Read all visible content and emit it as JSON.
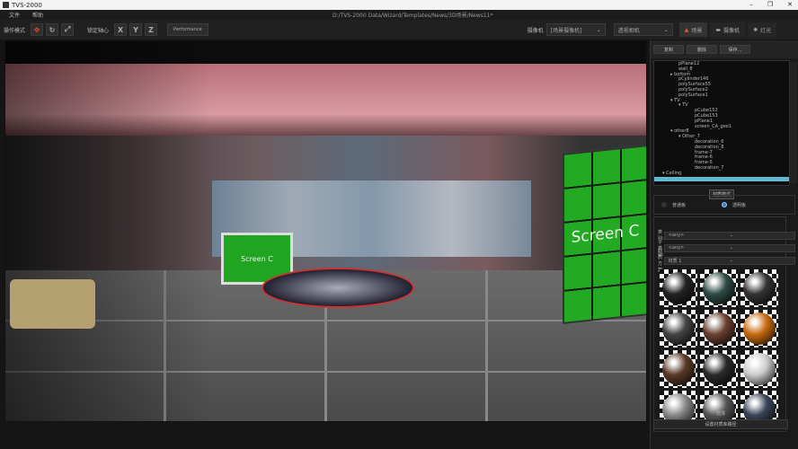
{
  "window": {
    "title": "TVS-2000",
    "minimize": "–",
    "restore": "❐",
    "close": "✕"
  },
  "menu": {
    "items": [
      "文件",
      "帮助"
    ],
    "path": "D:/TVS-2000 Data/Wizard/Templates/News/3D场景/News11*"
  },
  "toolbar": {
    "mode_label": "操作模式",
    "lock_label": "锁定轴心",
    "axes": [
      "X",
      "Y",
      "Z"
    ],
    "performance": "Performance",
    "camera_label": "摄像机",
    "camera_value": "[场景摄像机]",
    "view_value": "透视相机",
    "tabs": [
      "场景",
      "摄像机",
      "灯光"
    ]
  },
  "viewport": {
    "screen_big": "Screen C",
    "screen_small": "Screen C"
  },
  "panel": {
    "buttons": [
      "复制",
      "删除",
      "保存..."
    ],
    "tree": [
      {
        "t": "pPlane12",
        "d": 3
      },
      {
        "t": "wall_8",
        "d": 3
      },
      {
        "t": "▸ bottom",
        "d": 2
      },
      {
        "t": "pCylinder146",
        "d": 3
      },
      {
        "t": "polySurface55",
        "d": 3
      },
      {
        "t": "polySurface2",
        "d": 3
      },
      {
        "t": "polySurface1",
        "d": 3
      },
      {
        "t": "▾ TV",
        "d": 2
      },
      {
        "t": "▾ TV",
        "d": 3
      },
      {
        "t": "pCube152",
        "d": 5
      },
      {
        "t": "pCube153",
        "d": 5
      },
      {
        "t": "pPlane1",
        "d": 5
      },
      {
        "t": "screen_CA_geo1",
        "d": 5
      },
      {
        "t": "▾ other8",
        "d": 2
      },
      {
        "t": "▾ Other_7",
        "d": 3
      },
      {
        "t": "decoration_6",
        "d": 5
      },
      {
        "t": "decoration_8",
        "d": 5
      },
      {
        "t": "frame-7",
        "d": 5
      },
      {
        "t": "frame-6",
        "d": 5
      },
      {
        "t": "frame-5",
        "d": 5
      },
      {
        "t": "decoration_7",
        "d": 5
      },
      {
        "t": "▾ Ceiling",
        "d": 1
      }
    ],
    "tooltip": "材质模式",
    "radio": [
      "普通板",
      "透明板"
    ],
    "fields": [
      {
        "label": "类别:",
        "value": "<any>"
      },
      {
        "label": "子类别:",
        "value": "<any>"
      },
      {
        "label": "材质方案:",
        "value": "材质 1"
      }
    ],
    "select_label": "选择",
    "path_button": "设置材质库路径"
  },
  "colors": {
    "accent": "#5fb8d0",
    "green_screen": "#22aa22"
  }
}
